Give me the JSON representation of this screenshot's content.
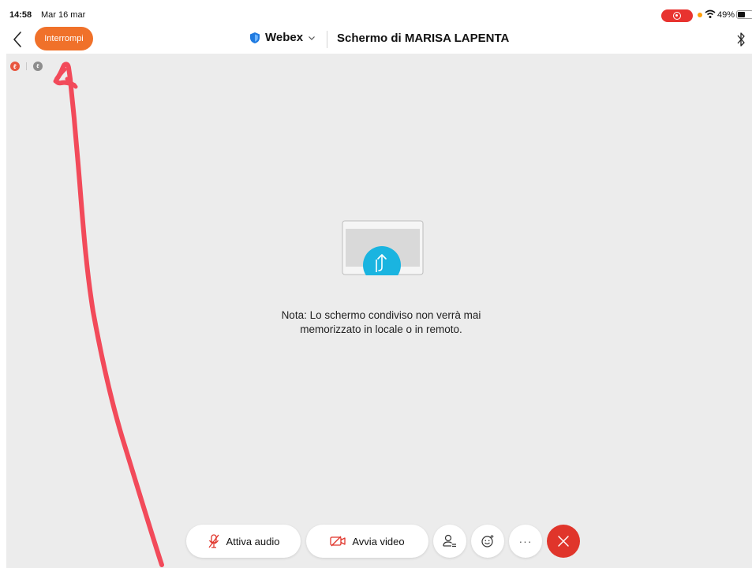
{
  "status_bar": {
    "time": "14:58",
    "date": "Mar 16 mar",
    "battery_text": "49%",
    "battery_level": 0.49,
    "recording_color": "#e8332f"
  },
  "header": {
    "stop_label": "Interrompi",
    "app_name": "Webex",
    "screen_title": "Schermo di MARISA LAPENTA",
    "accent_color": "#f0712a"
  },
  "share_area": {
    "note_line1": "Nota: Lo schermo condiviso non verrà mai",
    "note_line2": "memorizzato in locale o in remoto.",
    "share_icon_color": "#1ab4e0"
  },
  "toolbar": {
    "audio_label": "Attiva audio",
    "video_label": "Avvia video",
    "more_label": "···",
    "leave_color": "#e0352b"
  },
  "icons": [
    "back-chevron-icon",
    "shield-icon",
    "chevron-down-icon",
    "bluetooth-icon",
    "share-screen-icon",
    "mic-muted-icon",
    "video-off-icon",
    "participants-icon",
    "reaction-icon",
    "close-icon",
    "wifi-icon"
  ]
}
